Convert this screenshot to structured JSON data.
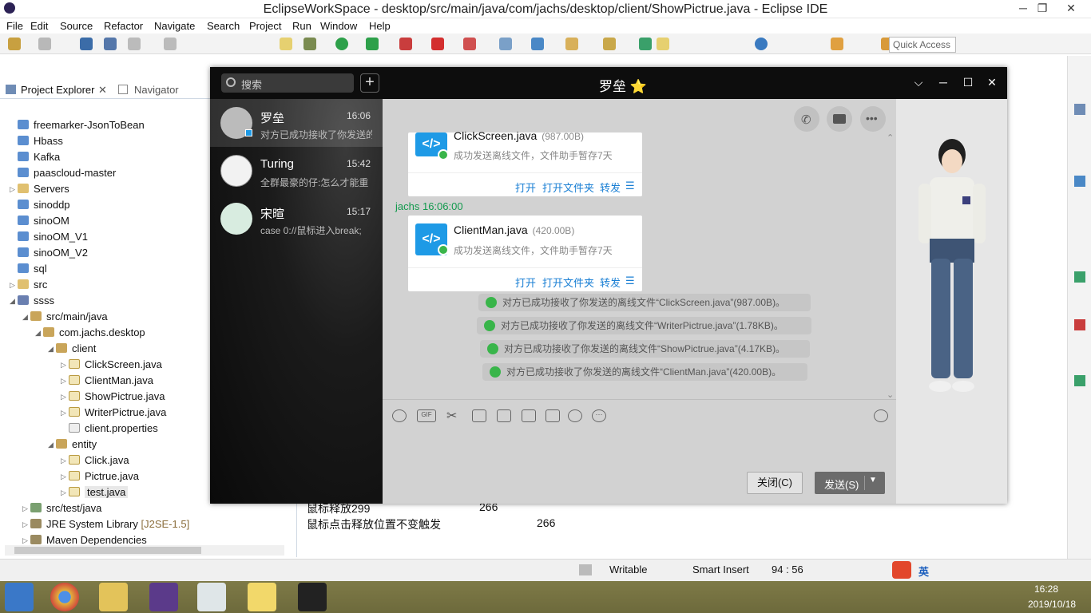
{
  "eclipse": {
    "title": "EclipseWorkSpace - desktop/src/main/java/com/jachs/desktop/client/ShowPictrue.java - Eclipse IDE",
    "menu": [
      "File",
      "Edit",
      "Source",
      "Refactor",
      "Navigate",
      "Search",
      "Project",
      "Run",
      "Window",
      "Help"
    ],
    "quick_access": "Quick Access",
    "tabs": {
      "project_explorer": "Project Explorer",
      "navigator": "Navigator"
    },
    "tree": [
      {
        "label": "freemarker-JsonToBean"
      },
      {
        "label": "Hbass"
      },
      {
        "label": "Kafka"
      },
      {
        "label": "paascloud-master"
      },
      {
        "label": "Servers"
      },
      {
        "label": "sinoddp"
      },
      {
        "label": "sinoOM"
      },
      {
        "label": "sinoOM_V1"
      },
      {
        "label": "sinoOM_V2"
      },
      {
        "label": "sql"
      },
      {
        "label": "src"
      },
      {
        "label": "ssss"
      },
      {
        "label": "src/main/java"
      },
      {
        "label": "com.jachs.desktop"
      },
      {
        "label": "client"
      },
      {
        "label": "ClickScreen.java"
      },
      {
        "label": "ClientMan.java"
      },
      {
        "label": "ShowPictrue.java"
      },
      {
        "label": "WriterPictrue.java"
      },
      {
        "label": "client.properties"
      },
      {
        "label": "entity"
      },
      {
        "label": "Click.java"
      },
      {
        "label": "Pictrue.java"
      },
      {
        "label": "test.java"
      },
      {
        "label": "src/test/java"
      },
      {
        "label": "JRE System Library",
        "suffix": "[J2SE-1.5]"
      },
      {
        "label": "Maven Dependencies"
      }
    ],
    "console_lines": [
      {
        "text": "鼠标释放299",
        "num": "266"
      },
      {
        "text": "鼠标点击释放位置不变触发",
        "num": "266"
      }
    ],
    "status": {
      "writable": "Writable",
      "insert": "Smart Insert",
      "position": "94 : 56"
    }
  },
  "chat_app": {
    "search_placeholder": "搜索",
    "window_title": "罗垒",
    "star": "⭐",
    "contacts": [
      {
        "name": "罗垒",
        "time": "16:06",
        "preview": "对方已成功接收了你发送的"
      },
      {
        "name": "Turing",
        "time": "15:42",
        "preview": "全群最豪的仔:怎么才能重"
      },
      {
        "name": "宋暄",
        "time": "15:17",
        "preview": "case 0://鼠标进入break;"
      }
    ],
    "messages": {
      "card1": {
        "name": "ClickScreen.java",
        "size": "(987.00B)",
        "desc": "成功发送离线文件，文件助手暂存7天"
      },
      "sender": "jachs  16:06:00",
      "card2": {
        "name": "ClientMan.java",
        "size": "(420.00B)",
        "desc": "成功发送离线文件，文件助手暂存7天"
      },
      "actions": {
        "open": "打开",
        "open_folder": "打开文件夹",
        "forward": "转发"
      },
      "system_notes": [
        "对方已成功接收了你发送的离线文件“ClickScreen.java”(987.00B)。",
        "对方已成功接收了你发送的离线文件“WriterPictrue.java”(1.78KB)。",
        "对方已成功接收了你发送的离线文件“ShowPictrue.java”(4.17KB)。",
        "对方已成功接收了你发送的离线文件“ClientMan.java”(420.00B)。"
      ]
    },
    "buttons": {
      "close": "关闭(C)",
      "send": "发送(S)"
    }
  },
  "tray": {
    "date": "2019/10/18",
    "time": "16:28",
    "ime": "英"
  },
  "colors": {
    "link": "#1a7fd4",
    "success": "#39b54a",
    "file_icon": "#1e9ae6",
    "sender": "#139a4e"
  }
}
